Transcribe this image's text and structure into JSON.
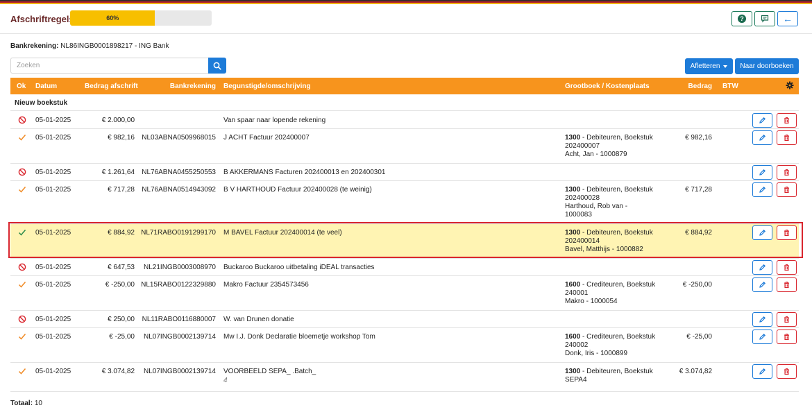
{
  "header": {
    "title": "Afschriftregels",
    "progress_label": "60%",
    "progress_value": 0.6,
    "help_icon_glyph": "?",
    "back_icon_glyph": "←"
  },
  "bank": {
    "label": "Bankrekening:",
    "value": "NL86INGB0001898217 - ING Bank"
  },
  "search": {
    "placeholder": "Zoeken",
    "value": ""
  },
  "actions": {
    "afletteren": "Afletteren",
    "doorboeken": "Naar doorboeken"
  },
  "table": {
    "headers": {
      "ok": "Ok",
      "datum": "Datum",
      "bedrag_afschrift": "Bedrag afschrift",
      "bankrekening": "Bankrekening",
      "begunstigde": "Begunstigde/omschrijving",
      "grootboek": "Grootboek / Kostenplaats",
      "bedrag": "Bedrag",
      "btw": "BTW"
    },
    "group_label": "Nieuw boekstuk",
    "rows": [
      {
        "status": "blocked",
        "date": "05-01-2025",
        "amount": "€ 2.000,00",
        "iban": "",
        "desc": "Van spaar naar lopende rekening",
        "memo": "",
        "gb_acc": "",
        "gb_text": "",
        "gb_boekstuk": "",
        "rel_name": "",
        "rel_num": "",
        "rel_num2": "",
        "bedrag": ""
      },
      {
        "status": "check",
        "date": "05-01-2025",
        "amount": "€ 982,16",
        "iban": "NL03ABNA0509968015",
        "desc": "J ACHT Factuur 202400007",
        "memo": "",
        "gb_acc": "1300",
        "gb_text": " - Debiteuren, Boekstuk",
        "gb_boekstuk": "202400007",
        "rel_name": "Acht, Jan",
        "rel_num": "1000879",
        "rel_num2": "",
        "bedrag": "€ 982,16"
      },
      {
        "status": "blocked",
        "date": "05-01-2025",
        "amount": "€ 1.261,64",
        "iban": "NL76ABNA0455250553",
        "desc": "B AKKERMANS Facturen 202400013 en 202400301",
        "memo": "",
        "gb_acc": "",
        "gb_text": "",
        "gb_boekstuk": "",
        "rel_name": "",
        "rel_num": "",
        "rel_num2": "",
        "bedrag": ""
      },
      {
        "status": "check",
        "date": "05-01-2025",
        "amount": "€ 717,28",
        "iban": "NL76ABNA0514943092",
        "desc": "B V HARTHOUD Factuur 202400028 (te weinig)",
        "memo": "",
        "gb_acc": "1300",
        "gb_text": " - Debiteuren, Boekstuk",
        "gb_boekstuk": "202400028",
        "rel_name": "Harthoud, Rob van",
        "rel_num": "",
        "rel_num2": "1000083",
        "bedrag": "€ 717,28"
      },
      {
        "status": "check-green",
        "date": "05-01-2025",
        "amount": "€ 884,92",
        "iban": "NL71RABO0191299170",
        "desc": "M BAVEL Factuur 202400014 (te veel)",
        "memo": "",
        "gb_acc": "1300",
        "gb_text": " - Debiteuren, Boekstuk",
        "gb_boekstuk": "202400014",
        "rel_name": "Bavel, Matthijs",
        "rel_num": "1000882",
        "rel_num2": "",
        "bedrag": "€ 884,92"
      },
      {
        "status": "blocked",
        "date": "05-01-2025",
        "amount": "€ 647,53",
        "iban": "NL21INGB0003008970",
        "desc": "Buckaroo Buckaroo uitbetaling iDEAL transacties",
        "memo": "",
        "gb_acc": "",
        "gb_text": "",
        "gb_boekstuk": "",
        "rel_name": "",
        "rel_num": "",
        "rel_num2": "",
        "bedrag": ""
      },
      {
        "status": "check",
        "date": "05-01-2025",
        "amount": "€ -250,00",
        "iban": "NL15RABO0122329880",
        "desc": "Makro Factuur 2354573456",
        "memo": "",
        "gb_acc": "1600",
        "gb_text": " - Crediteuren, Boekstuk",
        "gb_boekstuk": "240001",
        "rel_name": "Makro",
        "rel_num": "1000054",
        "rel_num2": "",
        "bedrag": "€ -250,00"
      },
      {
        "status": "blocked",
        "date": "05-01-2025",
        "amount": "€ 250,00",
        "iban": "NL11RABO0116880007",
        "desc": "W. van Drunen donatie",
        "memo": "",
        "gb_acc": "",
        "gb_text": "",
        "gb_boekstuk": "",
        "rel_name": "",
        "rel_num": "",
        "rel_num2": "",
        "bedrag": ""
      },
      {
        "status": "check",
        "date": "05-01-2025",
        "amount": "€ -25,00",
        "iban": "NL07INGB0002139714",
        "desc": "Mw I.J. Donk Declaratie bloemetje workshop Tom",
        "memo": "",
        "gb_acc": "1600",
        "gb_text": " - Crediteuren, Boekstuk",
        "gb_boekstuk": "240002",
        "rel_name": "Donk, Iris",
        "rel_num": "1000899",
        "rel_num2": "",
        "bedrag": "€ -25,00"
      },
      {
        "status": "check",
        "date": "05-01-2025",
        "amount": "€ 3.074,82",
        "iban": "NL07INGB0002139714",
        "desc": "VOORBEELD SEPA_ .Batch_",
        "memo": "4",
        "gb_acc": "1300",
        "gb_text": " - Debiteuren, Boekstuk",
        "gb_boekstuk": "SEPA4",
        "rel_name": "",
        "rel_num": "",
        "rel_num2": "",
        "bedrag": "€ 3.074,82"
      }
    ]
  },
  "footer": {
    "total_label": "Totaal:",
    "total_value": "10"
  },
  "colors": {
    "accent": "#f7941d",
    "primary": "#1d7bd8",
    "danger": "#d9262e",
    "check_orange": "#f08a24",
    "check_green": "#2a8a4a",
    "highlight": "#fff4b3"
  },
  "icons": {
    "blocked": "blocked-icon",
    "check": "check-icon",
    "edit": "pencil-icon",
    "delete": "trash-icon",
    "search": "search-icon",
    "settings": "gear-icon"
  }
}
